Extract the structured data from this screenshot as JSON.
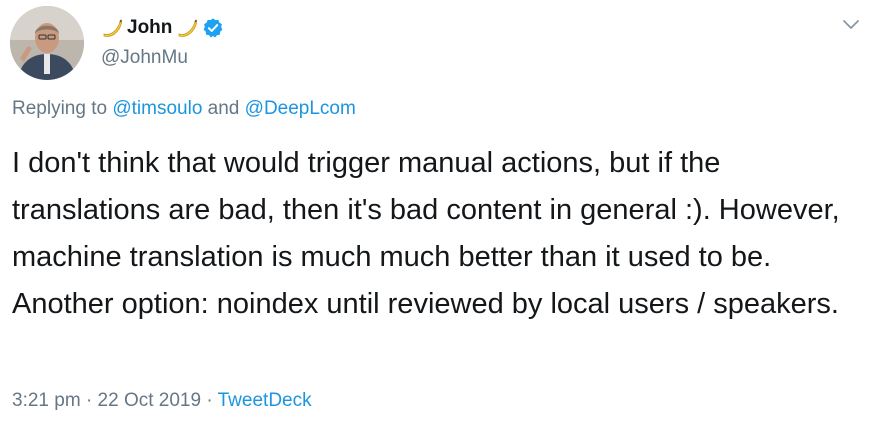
{
  "author": {
    "display_name": "John",
    "handle": "@JohnMu",
    "verified": true,
    "name_emoji": "banana"
  },
  "reply": {
    "prefix": "Replying to",
    "mention_1": "@timsoulo",
    "conjunction": "and",
    "mention_2": "@DeepLcom"
  },
  "tweet": {
    "text": "I don't think that would trigger manual actions, but if the translations are bad, then it's bad content in general :). However, machine translation is much much better than it used to be. Another option: noindex until reviewed by local users / speakers."
  },
  "meta": {
    "time": "3:21 pm",
    "separator_1": "·",
    "date": "22 Oct 2019",
    "separator_2": "·",
    "source": "TweetDeck"
  },
  "colors": {
    "text": "#14171a",
    "secondary": "#657786",
    "link": "#1b95e0",
    "verified": "#1da1f2",
    "banana": "#f7cd46"
  },
  "icons": {
    "verified": "verified-badge-icon",
    "caret": "chevron-down-icon",
    "emoji": "banana-icon"
  }
}
